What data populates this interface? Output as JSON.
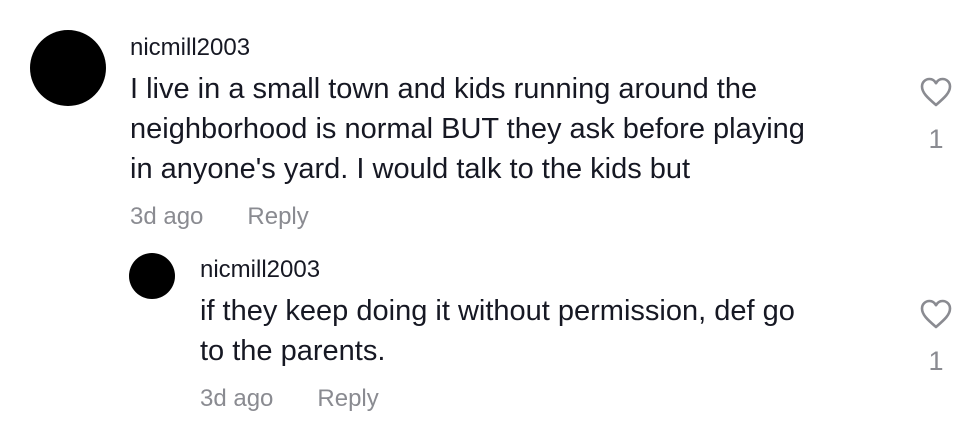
{
  "comments": [
    {
      "username": "nicmill2003",
      "text": "I live in a small town and kids running around the\nneighborhood is normal BUT they ask before playing\nin anyone's yard. I would talk to the kids but",
      "time": "3d ago",
      "reply_label": "Reply",
      "like_count": "1",
      "like_icon": "heart-outline-icon"
    },
    {
      "username": "nicmill2003",
      "text": "if they keep doing it without permission, def go\nto the parents.",
      "time": "3d ago",
      "reply_label": "Reply",
      "like_count": "1",
      "like_icon": "heart-outline-icon"
    }
  ],
  "colors": {
    "text_primary": "#161823",
    "text_secondary": "#8a8b91",
    "avatar": "#000000",
    "background": "#ffffff"
  }
}
